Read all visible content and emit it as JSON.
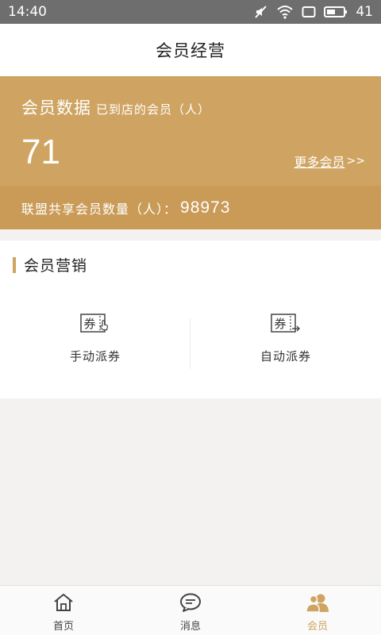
{
  "status_bar": {
    "time": "14:40",
    "battery": "41"
  },
  "header": {
    "title": "会员经营"
  },
  "member_card": {
    "title": "会员数据",
    "subtitle": "已到店的会员（人）",
    "count": "71",
    "more_link": "更多会员",
    "more_arrows": ">>",
    "alliance_label": "联盟共享会员数量（人）：",
    "alliance_count": "98973"
  },
  "marketing": {
    "title": "会员营销",
    "actions": [
      {
        "label": "手动派券",
        "icon": "coupon-hand-icon"
      },
      {
        "label": "自动派券",
        "icon": "coupon-auto-icon"
      }
    ]
  },
  "bottom_nav": {
    "items": [
      {
        "label": "首页",
        "icon": "home-icon",
        "active": false
      },
      {
        "label": "消息",
        "icon": "message-icon",
        "active": false
      },
      {
        "label": "会员",
        "icon": "members-icon",
        "active": true
      }
    ]
  },
  "coupon_glyph": "券",
  "colors": {
    "accent": "#cfa462",
    "accent_dark": "#c99b57",
    "status_bar": "#6e6e6e",
    "background": "#f3f2f0"
  }
}
